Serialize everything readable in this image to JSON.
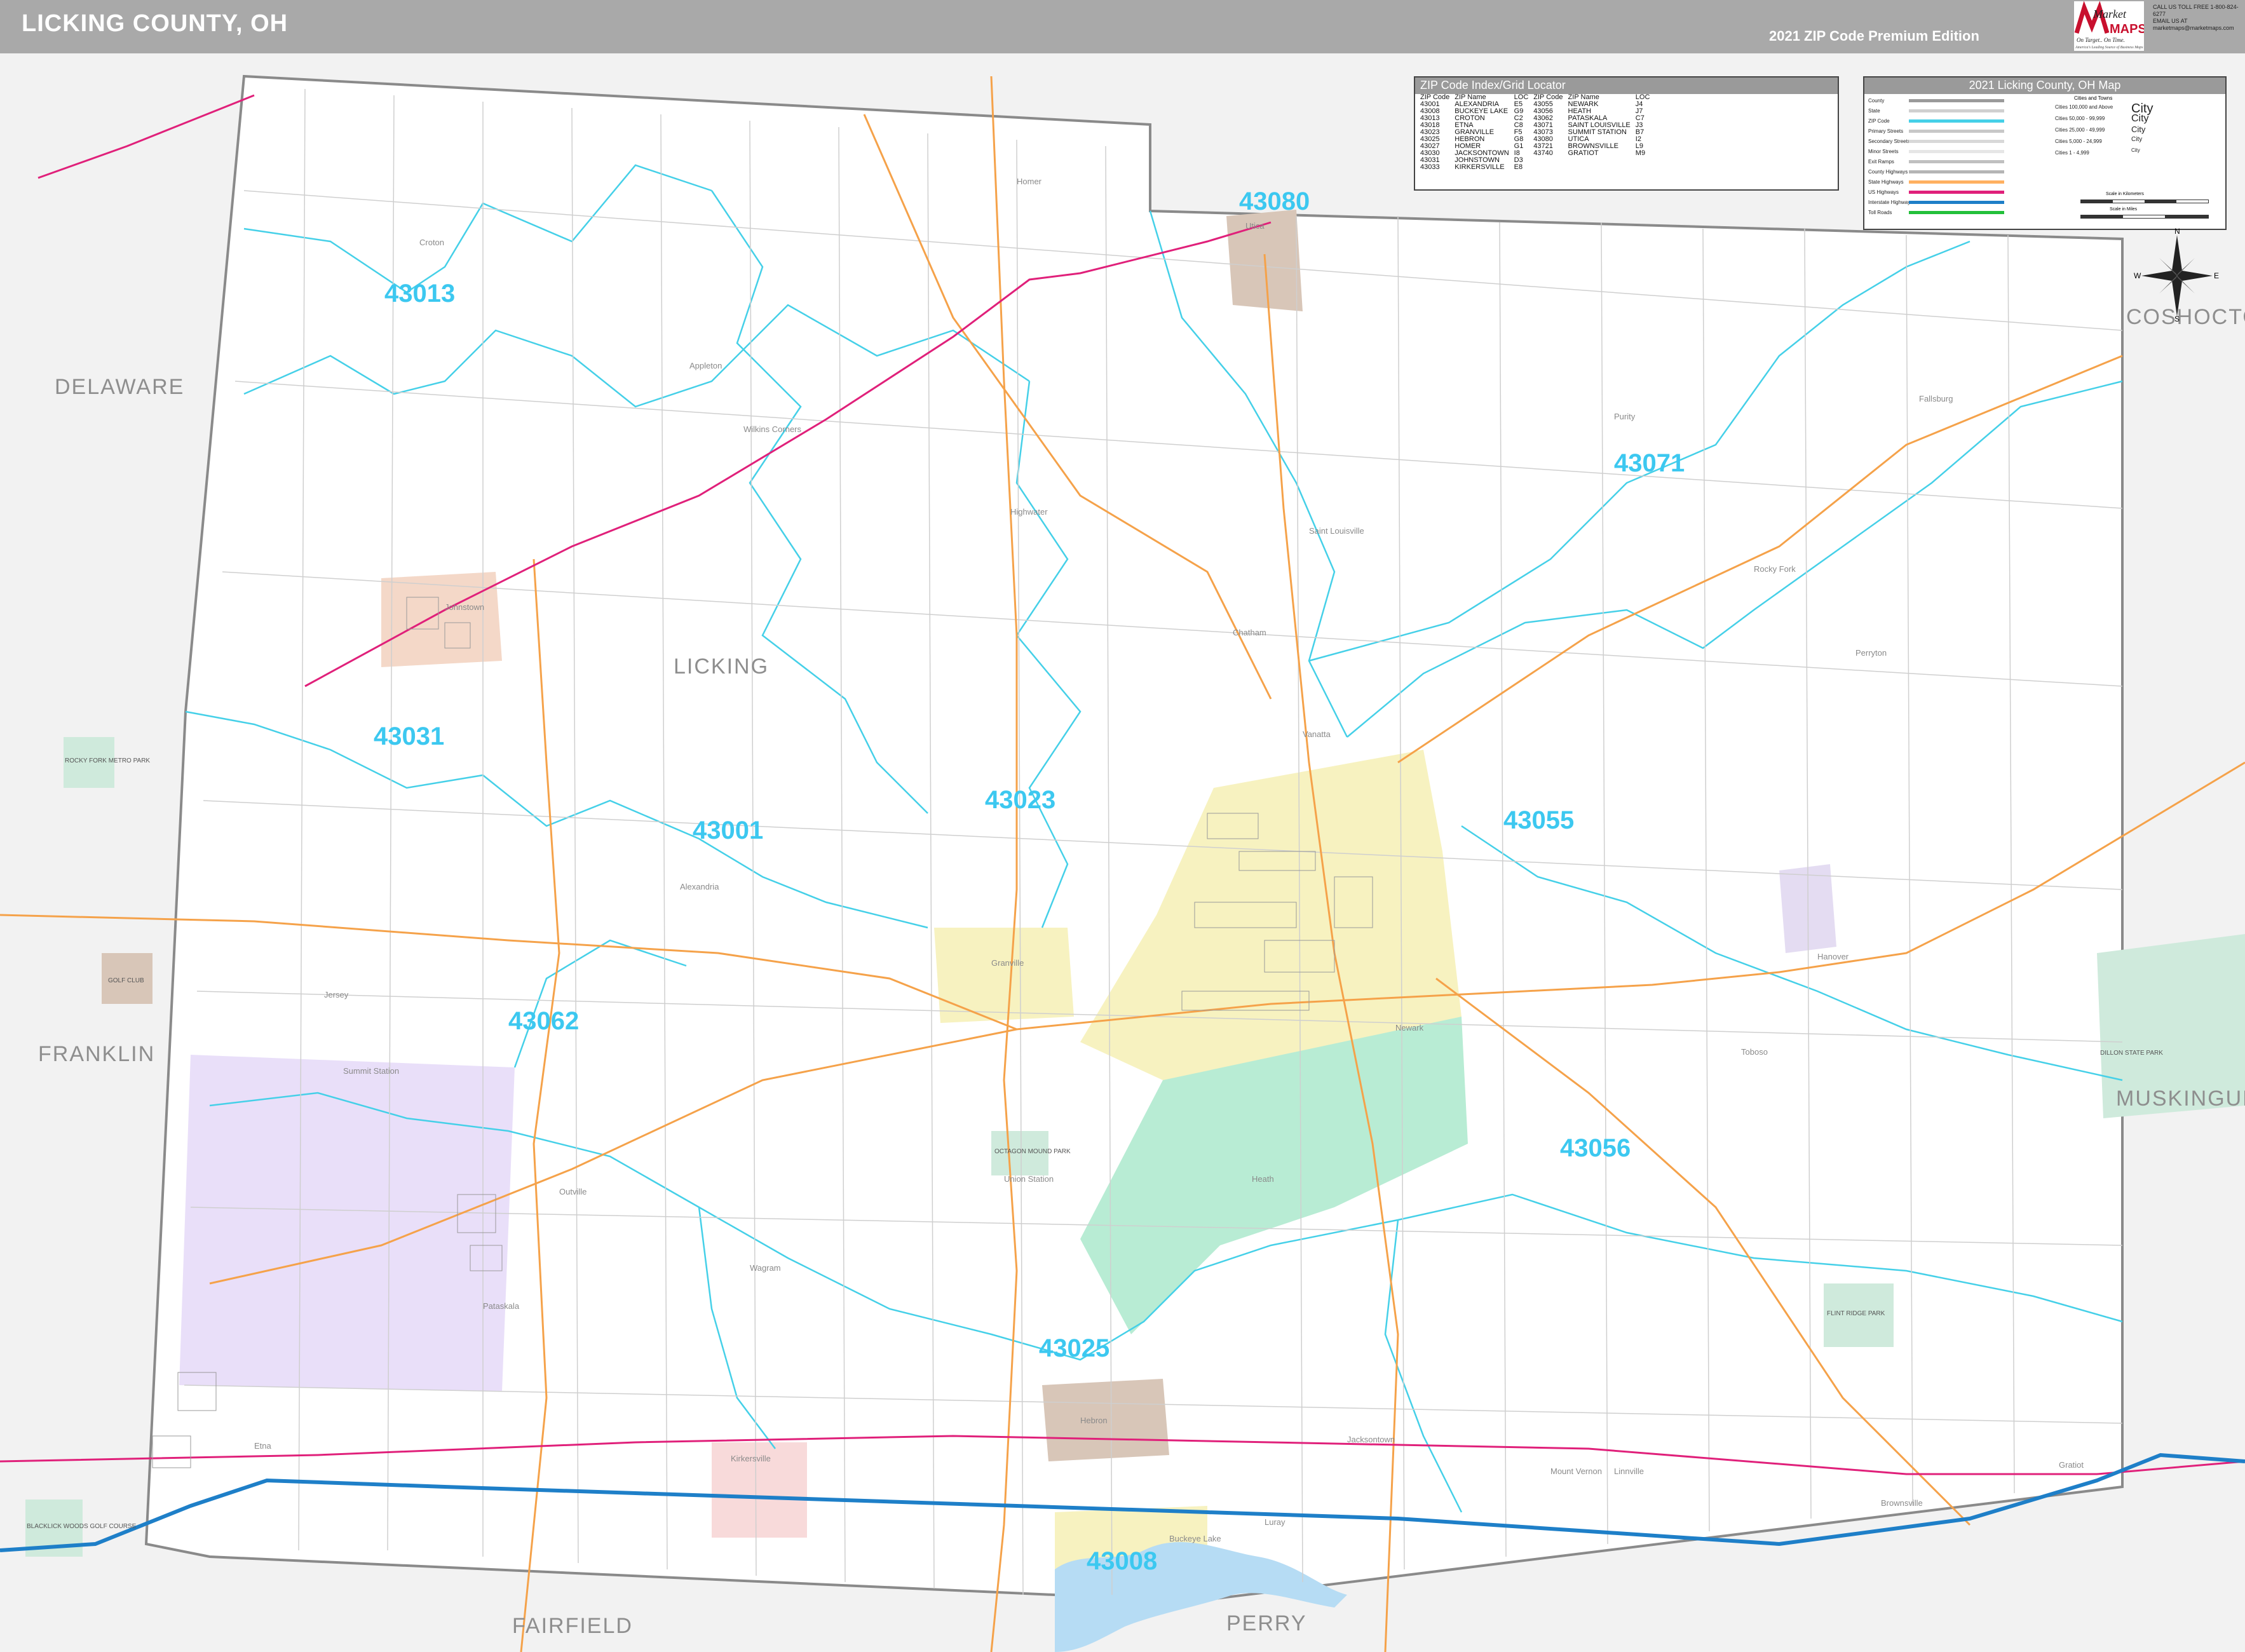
{
  "header": {
    "title": "LICKING COUNTY, OH",
    "edition": "2021 ZIP Code Premium Edition"
  },
  "logo": {
    "line1": "Market",
    "line2": "MAPS",
    "tagline": "On Target.. On Time.",
    "subtagline": "America's Leading Source of Business Maps"
  },
  "zip_index": {
    "title": "ZIP Code Index/Grid Locator",
    "headers": [
      "ZIP Code",
      "ZIP Name",
      "LOC",
      "ZIP Code",
      "ZIP Name",
      "LOC"
    ],
    "rows": [
      [
        "43001",
        "ALEXANDRIA",
        "E5",
        "43055",
        "NEWARK",
        "J4"
      ],
      [
        "43008",
        "BUCKEYE LAKE",
        "G9",
        "43056",
        "HEATH",
        "J7"
      ],
      [
        "43013",
        "CROTON",
        "C2",
        "43062",
        "PATASKALA",
        "C7"
      ],
      [
        "43018",
        "ETNA",
        "C8",
        "43071",
        "SAINT LOUISVILLE",
        "J3"
      ],
      [
        "43023",
        "GRANVILLE",
        "F5",
        "43073",
        "SUMMIT STATION",
        "B7"
      ],
      [
        "43025",
        "HEBRON",
        "G8",
        "43080",
        "UTICA",
        "I2"
      ],
      [
        "43027",
        "HOMER",
        "G1",
        "43721",
        "BROWNSVILLE",
        "L9"
      ],
      [
        "43030",
        "JACKSONTOWN",
        "I8",
        "43740",
        "GRATIOT",
        "M9"
      ],
      [
        "43031",
        "JOHNSTOWN",
        "D3",
        "",
        "",
        ""
      ],
      [
        "43033",
        "KIRKERSVILLE",
        "E8",
        "",
        "",
        ""
      ]
    ]
  },
  "legend": {
    "title": "2021 Licking County, OH Map",
    "items": [
      "County",
      "State",
      "ZIP Code",
      "Primary Streets",
      "Secondary Streets",
      "Minor Streets",
      "Exit Ramps",
      "County Highways",
      "State Highways",
      "US Highways",
      "Interstate Highways",
      "Toll Roads"
    ],
    "city_sizes": [
      "Cities 100,000 and Above",
      "Cities 50,000 - 99,999",
      "Cities 25,000 - 49,999",
      "Cities 5,000 - 24,999",
      "Cities 1 - 4,999"
    ],
    "city_samples": [
      "City",
      "City",
      "City",
      "City",
      "City"
    ],
    "city_column_heading": "Cities and Towns",
    "scale_km": "Scale in Kilometers",
    "scale_mi": "Scale in Miles",
    "colors": {
      "county": "#9a9a9a",
      "state": "#d0d0d0",
      "zip": "#45d0e8",
      "primary": "#c8c8c8",
      "secondary": "#d8d8d8",
      "minor": "#e6e6e6",
      "ramp": "#c0c0c0",
      "county_hwy": "#b5b5b5",
      "state_hwy": "#ffb060",
      "us_hwy": "#e0207a",
      "interstate": "#1e7fc8",
      "toll": "#22c03a"
    }
  },
  "compass": {
    "n": "N",
    "s": "S",
    "e": "E",
    "w": "W"
  },
  "zip_labels": [
    "43013",
    "43080",
    "43071",
    "43031",
    "43023",
    "43001",
    "43055",
    "43062",
    "43056",
    "43025",
    "43008"
  ],
  "neighbor_counties": [
    "DELAWARE",
    "FRANKLIN",
    "COSHOCTON",
    "MUSKINGUM",
    "FAIRFIELD",
    "PERRY"
  ],
  "county_label": "LICKING",
  "places": [
    "Croton",
    "Appleton",
    "Homer",
    "Utica",
    "Newark",
    "Heath",
    "Granville",
    "Alexandria",
    "Johnstown",
    "Pataskala",
    "Hebron",
    "Buckeye Lake",
    "Kirkersville",
    "Jacksontown",
    "Brownsville",
    "Gratiot",
    "Hanover",
    "Saint Louisville",
    "Fallsburg",
    "Rocky Fork",
    "Perryton",
    "Etna",
    "Summit Station",
    "Union Station",
    "Linnville",
    "Luray",
    "Mount Vernon",
    "Outville",
    "Toboso",
    "Chatham",
    "Vanatta",
    "Wilkins Corners",
    "Purity",
    "Highwater",
    "Wagram",
    "Jersey",
    "Fallsburg"
  ],
  "parks": {
    "golf_club": "GOLF CLUB",
    "mound_park": "OCTAGON MOUND PARK",
    "flint_ridge": "FLINT RIDGE PARK",
    "dillon": "DILLON STATE PARK",
    "blacklick": "BLACKLICK WOODS GOLF COURSE",
    "rocky_fork": "ROCKY FORK METRO PARK"
  },
  "contact": {
    "phone": "CALL US TOLL FREE 1-800-824-6277",
    "web": "EMAIL US AT marketmaps@marketmaps.com"
  }
}
